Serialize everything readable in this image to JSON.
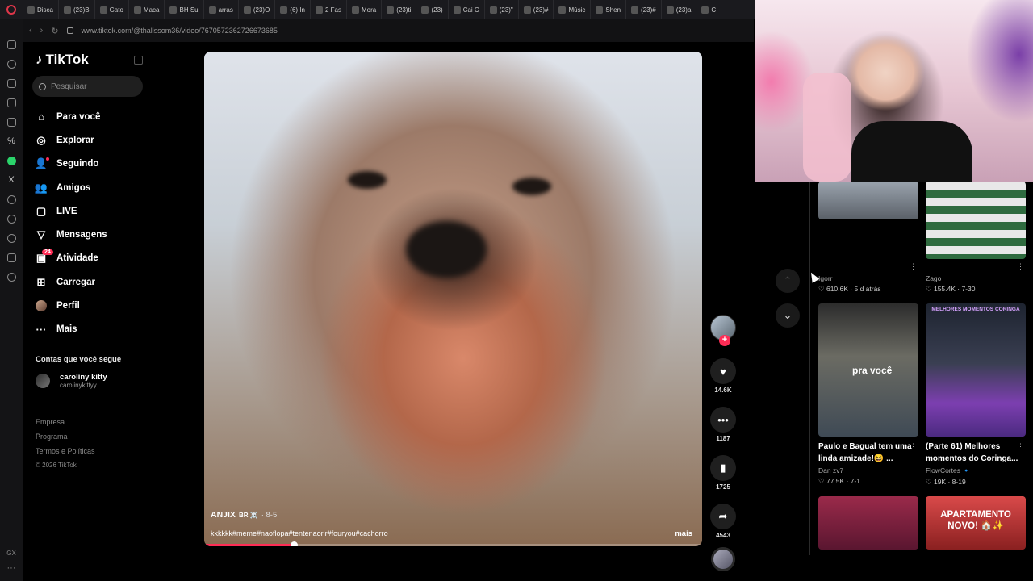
{
  "browser": {
    "tabs": [
      "Disca",
      "(23)B",
      "Gato",
      "Maca",
      "BH Su",
      "arras",
      "(23)O",
      "(6) In",
      "2 Fas",
      "Mora",
      "(23)ti",
      "(23)",
      "Cai C",
      "(23)\"",
      "(23)#",
      "Músic",
      "Shen",
      "(23)#",
      "(23)a",
      "C"
    ],
    "url": "www.tiktok.com/@thalissom36/video/7670572362726673685"
  },
  "sidebar": {
    "logo": "TikTok",
    "search_placeholder": "Pesquisar",
    "nav": [
      {
        "label": "Para você",
        "icon": "home-icon",
        "glyph": "⌂"
      },
      {
        "label": "Explorar",
        "icon": "compass-icon",
        "glyph": "◎"
      },
      {
        "label": "Seguindo",
        "icon": "following-icon",
        "glyph": "👤"
      },
      {
        "label": "Amigos",
        "icon": "friends-icon",
        "glyph": "👥"
      },
      {
        "label": "LIVE",
        "icon": "live-icon",
        "glyph": "▢"
      },
      {
        "label": "Mensagens",
        "icon": "messages-icon",
        "glyph": "▽"
      },
      {
        "label": "Atividade",
        "icon": "activity-icon",
        "glyph": "▣",
        "badge": "24"
      },
      {
        "label": "Carregar",
        "icon": "upload-icon",
        "glyph": "⊞"
      },
      {
        "label": "Perfil",
        "icon": "profile-avatar",
        "glyph": ""
      },
      {
        "label": "Mais",
        "icon": "more-icon",
        "glyph": "···"
      }
    ],
    "following_title": "Contas que você segue",
    "following": [
      {
        "name": "caroliny kitty",
        "handle": "carolinykittyy"
      }
    ],
    "footer": [
      "Empresa",
      "Programa",
      "Termos e Políticas"
    ],
    "copyright": "© 2026 TikTok"
  },
  "video": {
    "author": "ANJIX",
    "author_suffix": "BR ☠️",
    "date": "· 8-5",
    "caption": "kkkkkk#meme#naoflopa#tentenaorir#fouryou#cachorro",
    "more": "mais",
    "progress": 0.18
  },
  "actions": {
    "likes": "14.6K",
    "comments": "1187",
    "saves": "1725",
    "shares": "4543"
  },
  "recommendations": [
    {
      "title": "",
      "author": "Igorr",
      "stats": "♡ 610.6K · 5 d atrás"
    },
    {
      "title": "",
      "author": "Zago",
      "stats": "♡ 155.4K · 7-30"
    },
    {
      "title": "Paulo e Bagual tem uma linda amizade!😆 ...",
      "author": "Dan zv7",
      "stats": "♡ 77.5K · 7-1",
      "overlay": "pra você"
    },
    {
      "title": "(Parte 61) Melhores momentos do Coringa...",
      "author": "FlowCortes 🔹",
      "stats": "♡ 19K · 8-19",
      "overlay": "MELHORES MOMENTOS CORINGA"
    },
    {
      "title": "",
      "author": "",
      "stats": "",
      "overlay": ""
    },
    {
      "title": "",
      "author": "",
      "stats": "",
      "overlay": "APARTAMENTO NOVO! 🏠✨"
    }
  ],
  "colors": {
    "accent": "#fe2c55",
    "background": "#000000"
  }
}
